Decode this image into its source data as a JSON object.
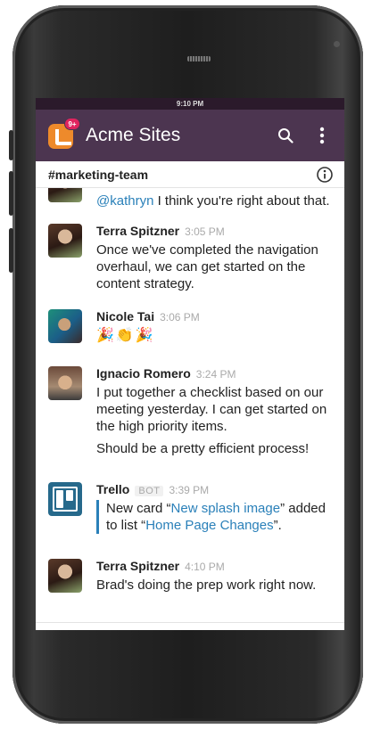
{
  "status": {
    "time": "9:10 PM"
  },
  "header": {
    "app_title": "Acme Sites",
    "badge_count": "9+"
  },
  "channel": {
    "name": "#marketing-team"
  },
  "messages": [
    {
      "id": "m0",
      "author": "",
      "time": "",
      "mention": "@kathryn",
      "text": " I think you're right about that."
    },
    {
      "id": "m1",
      "author": "Terra Spitzner",
      "time": "3:05 PM",
      "text": "Once we've completed the navigation overhaul, we can get started on the content strategy."
    },
    {
      "id": "m2",
      "author": "Nicole Tai",
      "time": "3:06 PM",
      "text": "🎉👏🎉"
    },
    {
      "id": "m3",
      "author": "Ignacio Romero",
      "time": "3:24 PM",
      "text": "I put together a checklist based on our meeting yesterday. I can get started on the high priority items.",
      "text2": "Should be a pretty efficient process!"
    },
    {
      "id": "m4",
      "author": "Trello",
      "bot_tag": "BOT",
      "time": "3:39 PM",
      "text_pre": "New card “",
      "card_link": "New splash image",
      "text_mid": "” added to list “",
      "list_link": "Home Page Changes",
      "text_post": "”."
    },
    {
      "id": "m5",
      "author": "Terra Spitzner",
      "time": "4:10 PM",
      "text": "Brad's doing the prep work right now."
    }
  ],
  "colors": {
    "appbar": "#4c3550",
    "statusbar": "#2b1a2b",
    "link": "#2a80b9",
    "badge": "#e0245e",
    "logo": "#ee8a2b"
  },
  "icons": {
    "search": "search-icon",
    "menu": "more-vert-icon",
    "info": "info-icon"
  }
}
